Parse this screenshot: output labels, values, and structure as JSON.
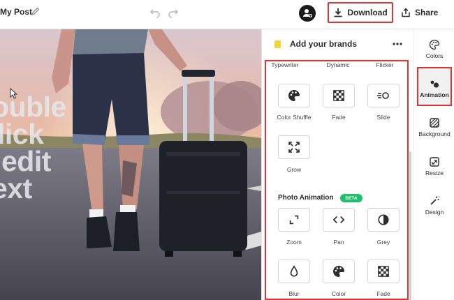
{
  "header": {
    "post_title": "My Post",
    "download_label": "Download",
    "share_label": "Share"
  },
  "canvas": {
    "overlay_lines": [
      "ouble",
      "lick",
      "edit",
      "ext"
    ]
  },
  "panel": {
    "title": "Add your brands",
    "top_row_labels": [
      "Typewriter",
      "Dynamic",
      "Flicker"
    ],
    "text_animations": [
      {
        "label": "Color Shuffle",
        "icon": "palette-icon"
      },
      {
        "label": "Fade",
        "icon": "checker-icon"
      },
      {
        "label": "Slide",
        "icon": "slide-icon"
      },
      {
        "label": "Grow",
        "icon": "expand-icon"
      }
    ],
    "photo_section_title": "Photo Animation",
    "beta_badge": "BETA",
    "photo_animations": [
      {
        "label": "Zoom",
        "icon": "zoom-corner-icon"
      },
      {
        "label": "Pan",
        "icon": "pan-arrows-icon"
      },
      {
        "label": "Grey",
        "icon": "half-circle-icon"
      },
      {
        "label": "Blur",
        "icon": "drop-icon"
      },
      {
        "label": "Color",
        "icon": "palette-icon"
      },
      {
        "label": "Fade",
        "icon": "checker-icon"
      }
    ]
  },
  "rail": {
    "items": [
      {
        "label": "Colors",
        "icon": "palette-outline-icon"
      },
      {
        "label": "Animation",
        "icon": "animation-icon"
      },
      {
        "label": "Background",
        "icon": "background-hatch-icon"
      },
      {
        "label": "Resize",
        "icon": "resize-icon"
      },
      {
        "label": "Design",
        "icon": "magic-wand-icon"
      }
    ],
    "active": "Animation"
  },
  "colors": {
    "highlight": "#e03434",
    "beta": "#1fbf6b",
    "brand": "#f2d33a"
  }
}
